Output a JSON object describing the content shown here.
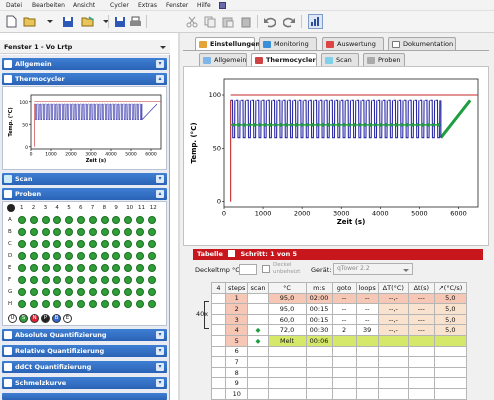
{
  "menu": [
    "Datei",
    "Bearbeiten",
    "Ansicht",
    "Cycler",
    "Extras",
    "Fenster",
    "Hilfe"
  ],
  "window_title": "Fenster 1 - Vo Lrtp",
  "left": {
    "sections": [
      "Allgemein",
      "Thermocycler",
      "Scan",
      "Proben",
      "Absolute Quantifizierung",
      "Relative Quantifizierung",
      "ddCt Quantifizierung",
      "Schmelzkurve"
    ],
    "mini_plot": {
      "ylabel": "Temp. (°C)",
      "xlabel": "Zeit (s)",
      "yticks": [
        "100",
        "50",
        "0"
      ],
      "xticks": [
        "0",
        "1000",
        "2000",
        "3000",
        "4000",
        "5000",
        "6000"
      ]
    },
    "plate_cols": [
      "1",
      "2",
      "3",
      "4",
      "5",
      "6",
      "7",
      "8",
      "9",
      "10",
      "11",
      "12"
    ],
    "plate_rows": [
      "A",
      "B",
      "C",
      "D",
      "E",
      "F",
      "G",
      "H"
    ],
    "legend_letters": [
      "U",
      "S",
      "N",
      "P",
      "B",
      "E"
    ]
  },
  "tabs": [
    "Einstellungen",
    "Monitoring",
    "Auswertung",
    "Dokumentation"
  ],
  "subtabs": [
    "Allgemein",
    "Thermocycler",
    "Scan",
    "Proben"
  ],
  "chart_data": {
    "type": "line",
    "title": "",
    "xlabel": "Zeit (s)",
    "ylabel": "Temp. (°C)",
    "xlim": [
      0,
      6500
    ],
    "ylim": [
      -5,
      115
    ],
    "yticks": [
      0,
      50,
      100
    ],
    "xticks": [
      0,
      1000,
      2000,
      3000,
      4000,
      5000,
      6000
    ],
    "cycles": 40,
    "cycle_start": 170,
    "cycle_end": 5550,
    "high_temp": 95,
    "low_temp": 60,
    "scan_temp": 72,
    "melt": {
      "x": [
        5550,
        6300
      ],
      "y": [
        60,
        95
      ]
    },
    "hold_line": 100
  },
  "tabelle": {
    "title": "Tabelle",
    "step_label": "Schritt: 1 von 5",
    "deckel_label": "Deckeltmp °C:",
    "deckel_check": "Deckel unbeheizt",
    "geraet_label": "Gerät:",
    "geraet_value": "qTower 2.2",
    "loop_label": "40x",
    "headers": [
      "4",
      "steps",
      "scan",
      "°C",
      "m:s",
      "goto",
      "loops",
      "ΔT(°C)",
      "Δt(s)",
      "↗(°C/s)"
    ],
    "rows": [
      [
        "",
        "1",
        "",
        "95,0",
        "02:00",
        "--",
        "--",
        "--,-",
        "---",
        "5,0"
      ],
      [
        "",
        "2",
        "",
        "95,0",
        "00:15",
        "--",
        "--",
        "--,-",
        "---",
        "5,0"
      ],
      [
        "",
        "3",
        "",
        "60,0",
        "00:15",
        "--",
        "--",
        "--,-",
        "---",
        "5,0"
      ],
      [
        "",
        "4",
        "◆",
        "72,0",
        "00:30",
        "2",
        "39",
        "--,-",
        "---",
        "5,0"
      ],
      [
        "",
        "5",
        "◆",
        "Melt",
        "00:06",
        "",
        "",
        "",
        "",
        ""
      ],
      [
        "",
        "6",
        "",
        "",
        "",
        "",
        "",
        "",
        "",
        ""
      ],
      [
        "",
        "7",
        "",
        "",
        "",
        "",
        "",
        "",
        "",
        ""
      ],
      [
        "",
        "8",
        "",
        "",
        "",
        "",
        "",
        "",
        "",
        ""
      ],
      [
        "",
        "9",
        "",
        "",
        "",
        "",
        "",
        "",
        "",
        ""
      ],
      [
        "",
        "10",
        "",
        "",
        "",
        "",
        "",
        "",
        "",
        ""
      ]
    ]
  }
}
